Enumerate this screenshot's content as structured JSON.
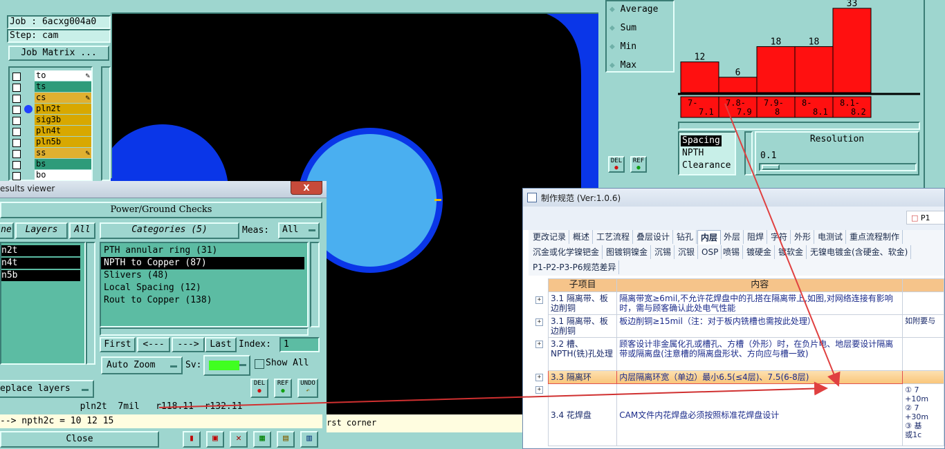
{
  "job": {
    "job_label": "Job : 6acxg004a0",
    "step_label": "Step: cam",
    "matrix_button": "Job Matrix ..."
  },
  "layers": [
    {
      "name": "to",
      "color": "#ffffff",
      "mark": true,
      "active": false
    },
    {
      "name": "ts",
      "color": "#2e9b7a",
      "mark": false,
      "active": false
    },
    {
      "name": "cs",
      "color": "#e0b030",
      "mark": true,
      "active": false
    },
    {
      "name": "pln2t",
      "color": "#d8a800",
      "mark": false,
      "active": true
    },
    {
      "name": "sig3b",
      "color": "#d8a800",
      "mark": false,
      "active": false
    },
    {
      "name": "pln4t",
      "color": "#d8a800",
      "mark": false,
      "active": false
    },
    {
      "name": "pln5b",
      "color": "#d8a800",
      "mark": false,
      "active": false
    },
    {
      "name": "ss",
      "color": "#e0b030",
      "mark": true,
      "active": false
    },
    {
      "name": "bs",
      "color": "#2e9b7a",
      "mark": false,
      "active": false
    },
    {
      "name": "bo",
      "color": "#ffffff",
      "mark": false,
      "active": false
    }
  ],
  "stats": {
    "options": [
      "Average",
      "Sum",
      "Min",
      "Max"
    ]
  },
  "histogram": {
    "chart_data": {
      "type": "bar",
      "categories": [
        "7-\n7.1",
        "7.8-\n7.9",
        "7.9-\n8",
        "8-\n8.1",
        "8.1-\n8.2"
      ],
      "values": [
        12,
        6,
        18,
        18,
        33
      ],
      "ylim": [
        0,
        33
      ]
    },
    "bar_color": "#ff1010"
  },
  "measure": {
    "items": [
      "Spacing",
      "NPTH",
      "Clearance"
    ],
    "resolution_label": "Resolution",
    "resolution_value": "0.1",
    "del": "DEL",
    "ref": "REF"
  },
  "results_viewer": {
    "title": "esults viewer",
    "close_x": "X",
    "header": "Power/Ground Checks",
    "tab_partial": "ne",
    "tab_layers": "Layers",
    "tab_all": "All",
    "layer_list": [
      "n2t",
      "n4t",
      "n5b"
    ],
    "categories_label": "Categories (5)",
    "meas_label": "Meas:",
    "meas_value": "All",
    "categories": [
      "PTH annular ring (31)",
      "NPTH to Copper (87)",
      "Slivers (48)",
      "Local Spacing (12)",
      "Rout to Copper (138)"
    ],
    "selected_index": 1,
    "nav": {
      "first": "First",
      "prev": "<---",
      "next": "--->",
      "last": "Last",
      "index_label": "Index:",
      "index_value": "1"
    },
    "auto_zoom": "Auto Zoom",
    "sv_label": "Sv:",
    "show_all": "Show All",
    "replace_layers": "eplace layers",
    "del": "DEL",
    "ref": "REF",
    "undo": "UNDO",
    "status_line": "pln2t  7mil   r118.11  r132.11",
    "message_line": "--> npth2c = 10 12 15",
    "close": "Close",
    "hint": "rst corner"
  },
  "doc": {
    "title": "制作规范 (Ver:1.0.6)",
    "side_tab": "P1",
    "tabs_row1": [
      "更改记录",
      "概述",
      "工艺流程",
      "叠层设计",
      "钻孔",
      "内层",
      "外层",
      "阻焊",
      "字符",
      "外形",
      "电测试",
      "重点流程制作"
    ],
    "active_tab": "内层",
    "tabs_row2": [
      "沉金或化学镍钯金",
      "图镀铜镍金",
      "沉锡",
      "沉银",
      "OSP",
      "喷锡",
      "镀硬金",
      "镀软金",
      "无镍电镀金(含硬金、软金)"
    ],
    "tabs_row3": [
      "P1-P2-P3-P6规范差异"
    ],
    "headers": [
      "子项目",
      "内容"
    ],
    "rows": [
      {
        "item": "3.1 隔离带、板边削铜",
        "content": "隔离带宽≥6mil,不允许花焊盘中的孔搭在隔离带上,如图,对网络连接有影响时，需与顾客确认此处电气性能",
        "extra": "",
        "highlight": false
      },
      {
        "item": "3.1 隔离带、板边削铜",
        "content": "板边削铜≥15mil（注：对于板内铣槽也需按此处理）",
        "extra": "如附要与",
        "highlight": false
      },
      {
        "item": "3.2 槽、NPTH(铣)孔处理",
        "content": "顾客设计非金属化孔或槽孔、方槽（外形）时，在负片电、地层要设计隔离带或隔离盘(注意槽的隔离盘形状、方向应与槽一致)",
        "extra": "",
        "highlight": false
      },
      {
        "item": "3.3 隔离环",
        "content": "内层隔离环宽（单边）最小6.5(≤4层)、7.5(6-8层)",
        "extra": "",
        "highlight": true
      },
      {
        "item": "3.4 花焊盘",
        "content": "CAM文件内花焊盘必须按照标准花焊盘设计",
        "extra": "① 7\n+10m\n② 7\n+30m\n③ 基\n或1c",
        "highlight": false
      }
    ]
  }
}
